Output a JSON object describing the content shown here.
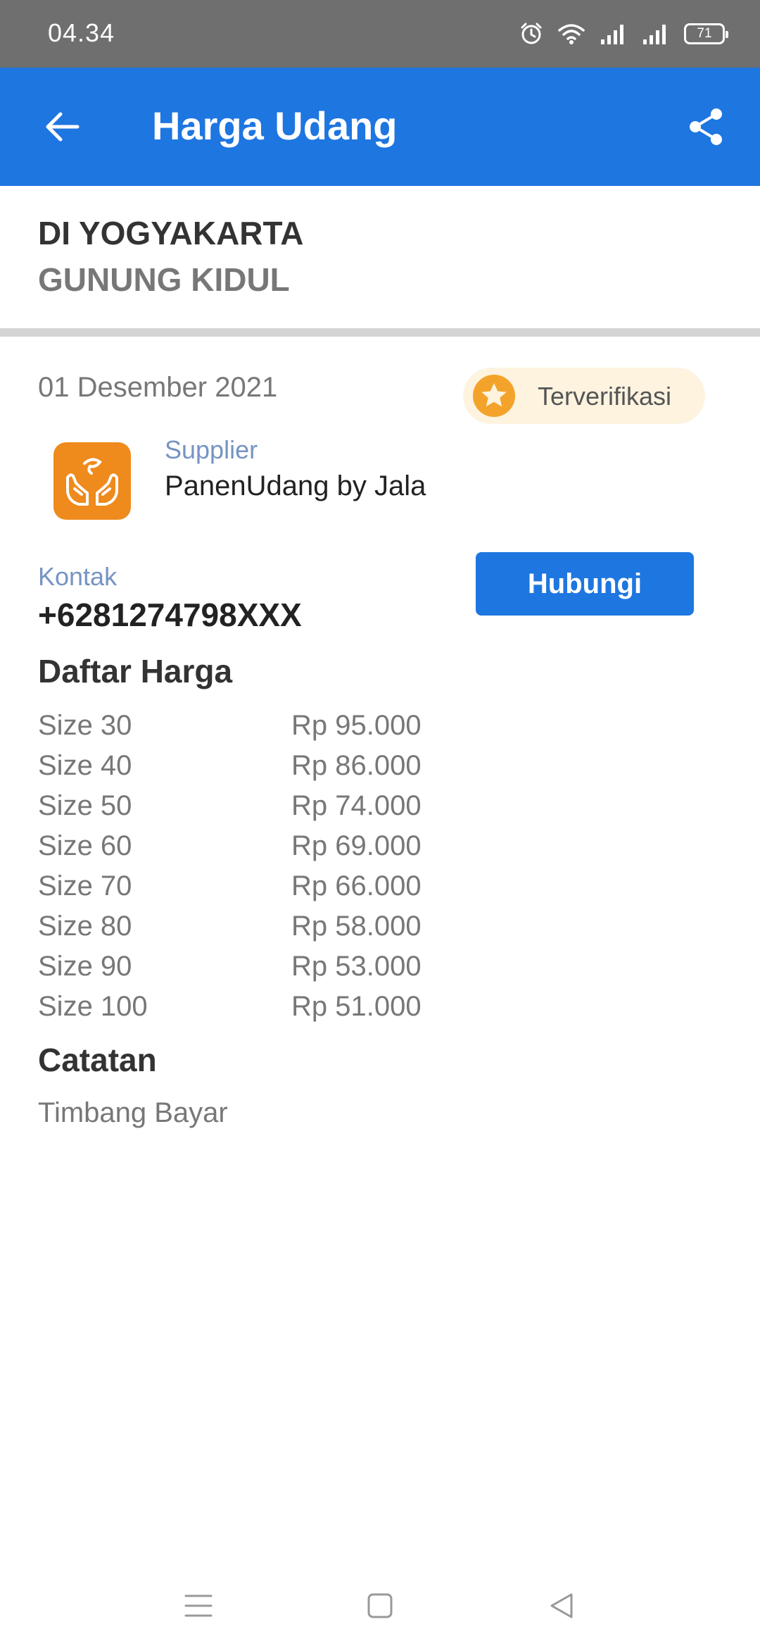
{
  "status_bar": {
    "time": "04.34",
    "battery": "71",
    "icons": [
      "alarm-icon",
      "wifi-icon",
      "signal-icon",
      "signal-icon",
      "battery-icon"
    ]
  },
  "app_bar": {
    "title": "Harga Udang",
    "back_icon": "arrow-left-icon",
    "share_icon": "share-icon",
    "background": "#1e76e0"
  },
  "location": {
    "province": "DI YOGYAKARTA",
    "regency": "GUNUNG KIDUL"
  },
  "detail": {
    "date": "01 Desember 2021",
    "verified_label": "Terverifikasi",
    "supplier_caption": "Supplier",
    "supplier_name": "PanenUdang by Jala",
    "contact_caption": "Kontak",
    "contact_number": "+6281274798XXX",
    "contact_button": "Hubungi"
  },
  "price_list": {
    "title": "Daftar Harga",
    "rows": [
      {
        "size": "Size 30",
        "price": "Rp 95.000"
      },
      {
        "size": "Size 40",
        "price": "Rp 86.000"
      },
      {
        "size": "Size 50",
        "price": "Rp 74.000"
      },
      {
        "size": "Size 60",
        "price": "Rp 69.000"
      },
      {
        "size": "Size 70",
        "price": "Rp 66.000"
      },
      {
        "size": "Size 80",
        "price": "Rp 58.000"
      },
      {
        "size": "Size 90",
        "price": "Rp 53.000"
      },
      {
        "size": "Size 100",
        "price": "Rp 51.000"
      }
    ]
  },
  "notes": {
    "title": "Catatan",
    "text": "Timbang Bayar"
  },
  "nav_bar": {
    "icons": [
      "menu-icon",
      "home-square-icon",
      "back-triangle-icon"
    ]
  },
  "colors": {
    "accent": "#1e76e0",
    "status_bar": "#6f6f6f",
    "badge_bg": "#fdf3df",
    "star": "#f4a32a",
    "logo": "#ef8a1c",
    "caption": "#7694c4"
  }
}
